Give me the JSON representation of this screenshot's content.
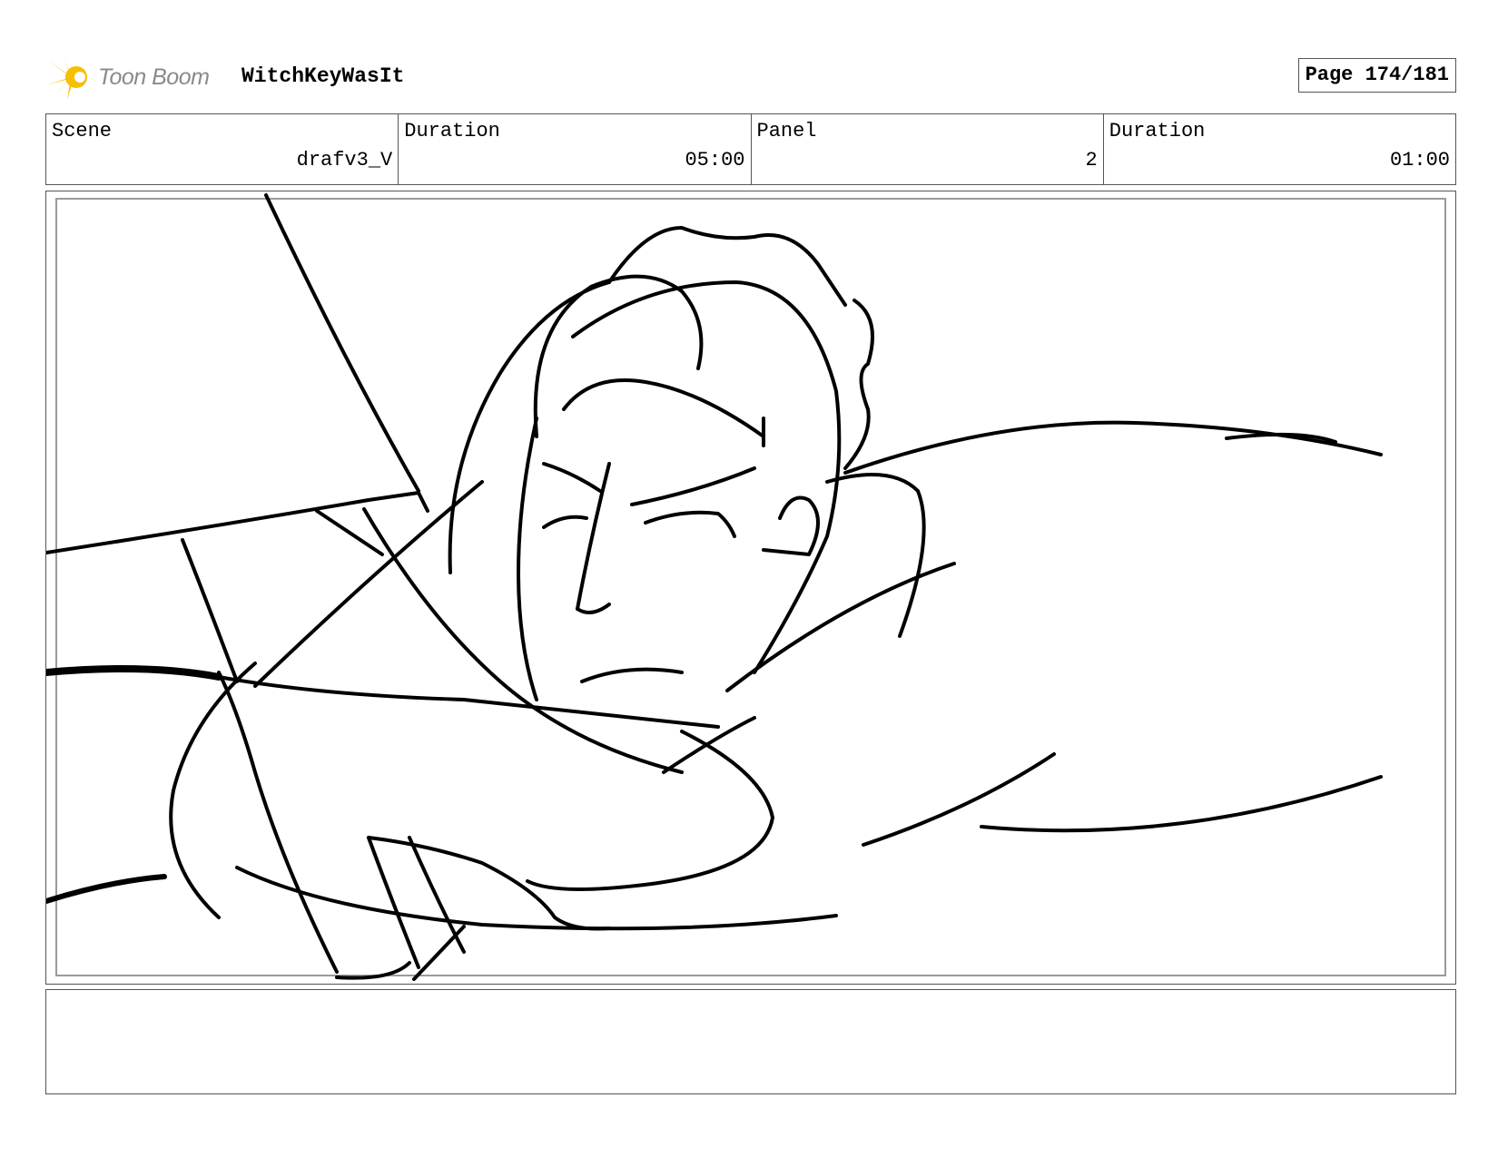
{
  "header": {
    "logo_text": "Toon Boom",
    "project_title": "WitchKeyWasIt",
    "page_label": "Page 174/181"
  },
  "info": {
    "scene_label": "Scene",
    "scene_value": "drafv3_V",
    "scene_duration_label": "Duration",
    "scene_duration_value": "05:00",
    "panel_label": "Panel",
    "panel_value": "2",
    "panel_duration_label": "Duration",
    "panel_duration_value": "01:00"
  },
  "colors": {
    "logo_star": "#f5c000",
    "logo_text": "#8a8a8a",
    "border": "#555555",
    "sketch": "#000000"
  },
  "icons": {
    "logo": "toon-boom-star-icon"
  },
  "notes": {
    "text": ""
  }
}
